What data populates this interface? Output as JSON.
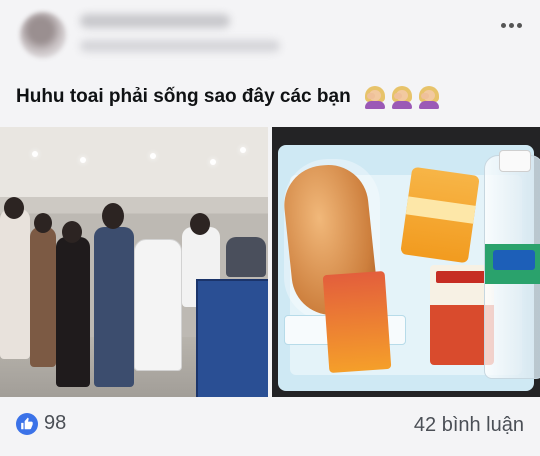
{
  "post": {
    "menu_icon": "more-horizontal-icon",
    "caption": "Huhu toai phải sống sao đây các bạn",
    "caption_emoji": [
      "woman-facepalming-icon",
      "woman-facepalming-icon",
      "woman-facepalming-icon"
    ],
    "photos": [
      {
        "name": "quarantine-check-in-photo"
      },
      {
        "name": "meal-tray-photo"
      }
    ]
  },
  "reactions": {
    "icon": "like-icon",
    "count": "98"
  },
  "comments": {
    "count_text": "42 bình luận"
  },
  "colors": {
    "accent": "#3b72e8",
    "text": "#101214",
    "meta": "#4b4f56",
    "background": "#f4f4f6"
  }
}
